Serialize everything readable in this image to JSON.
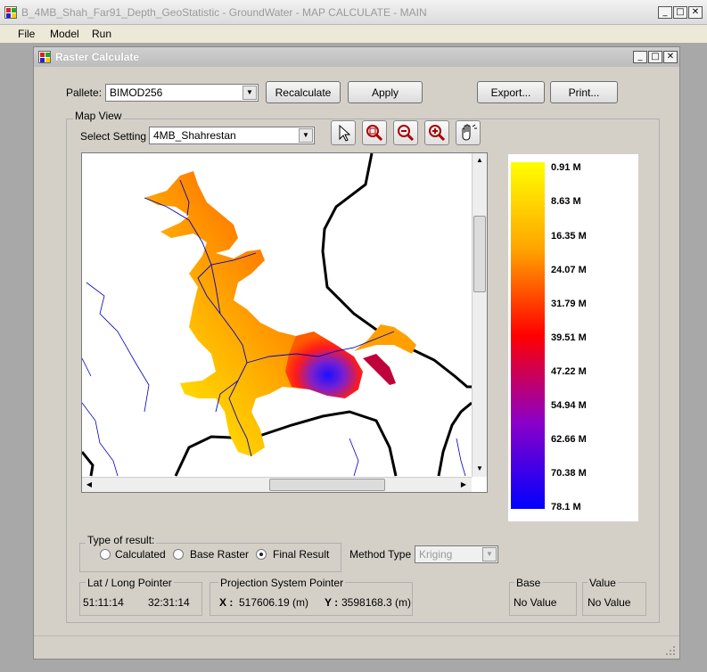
{
  "main_window": {
    "title": "B_4MB_Shah_Far91_Depth_GeoStatistic - GroundWater - MAP CALCULATE - MAIN",
    "menu": [
      "File",
      "Model",
      "Run"
    ]
  },
  "child_window": {
    "title": "Raster Calculate",
    "pallete_label": "Pallete:",
    "pallete_value": "BIMOD256",
    "buttons": {
      "recalculate": "Recalculate",
      "apply": "Apply",
      "export": "Export...",
      "print": "Print..."
    },
    "map_view": {
      "group_label": "Map View",
      "select_setting_label": "Select Setting :",
      "select_setting_value": "4MB_Shahrestan",
      "tools": [
        "pointer-icon",
        "zoom-extent-icon",
        "zoom-out-icon",
        "zoom-in-icon",
        "pan-hand-icon"
      ]
    },
    "legend": {
      "labels": [
        "0.91 M",
        "8.63 M",
        "16.35 M",
        "24.07 M",
        "31.79 M",
        "39.51 M",
        "47.22 M",
        "54.94 M",
        "62.66 M",
        "70.38 M",
        "78.1 M"
      ],
      "colors": [
        "#ffff00",
        "#ffa500",
        "#ff0000",
        "#8b00c8",
        "#0000ff"
      ]
    },
    "type_of_result": {
      "label": "Type of result:",
      "options": [
        "Calculated",
        "Base Raster",
        "Final Result"
      ],
      "selected": "Final Result"
    },
    "method_type": {
      "label": "Method Type :",
      "value": "Kriging"
    },
    "latlong": {
      "label": "Lat / Long Pointer",
      "lat": "51:11:14",
      "long": "32:31:14"
    },
    "projection": {
      "label": "Projection System Pointer",
      "x_label": "X :",
      "x_value": "517606.19 (m)",
      "y_label": "Y :",
      "y_value": "3598168.3 (m)"
    },
    "base": {
      "label": "Base",
      "value": "No Value"
    },
    "value": {
      "label": "Value",
      "value": "No Value"
    }
  }
}
